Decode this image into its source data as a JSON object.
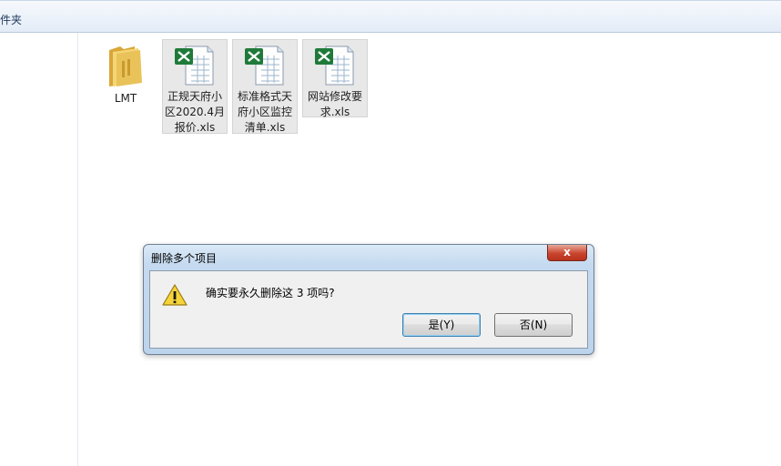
{
  "toolbar": {
    "partial_label": "件夹"
  },
  "files": [
    {
      "name": "LMT",
      "icon": "folder-icon"
    },
    {
      "name": "正规天府小区2020.4月报价.xls",
      "icon": "excel-file-icon"
    },
    {
      "name": "标准格式天府小区监控清单.xls",
      "icon": "excel-file-icon"
    },
    {
      "name": "网站修改要求.xls",
      "icon": "excel-file-icon"
    }
  ],
  "dialog": {
    "title": "删除多个项目",
    "close_glyph": "x",
    "icon": "warning-icon",
    "message": "确实要永久删除这 3 项吗?",
    "yes_label": "是(Y)",
    "no_label": "否(N)"
  },
  "colors": {
    "excel_green": "#1f7a3a",
    "folder_yellow": "#e8c25a",
    "dialog_frame": "#bcd3ec"
  }
}
